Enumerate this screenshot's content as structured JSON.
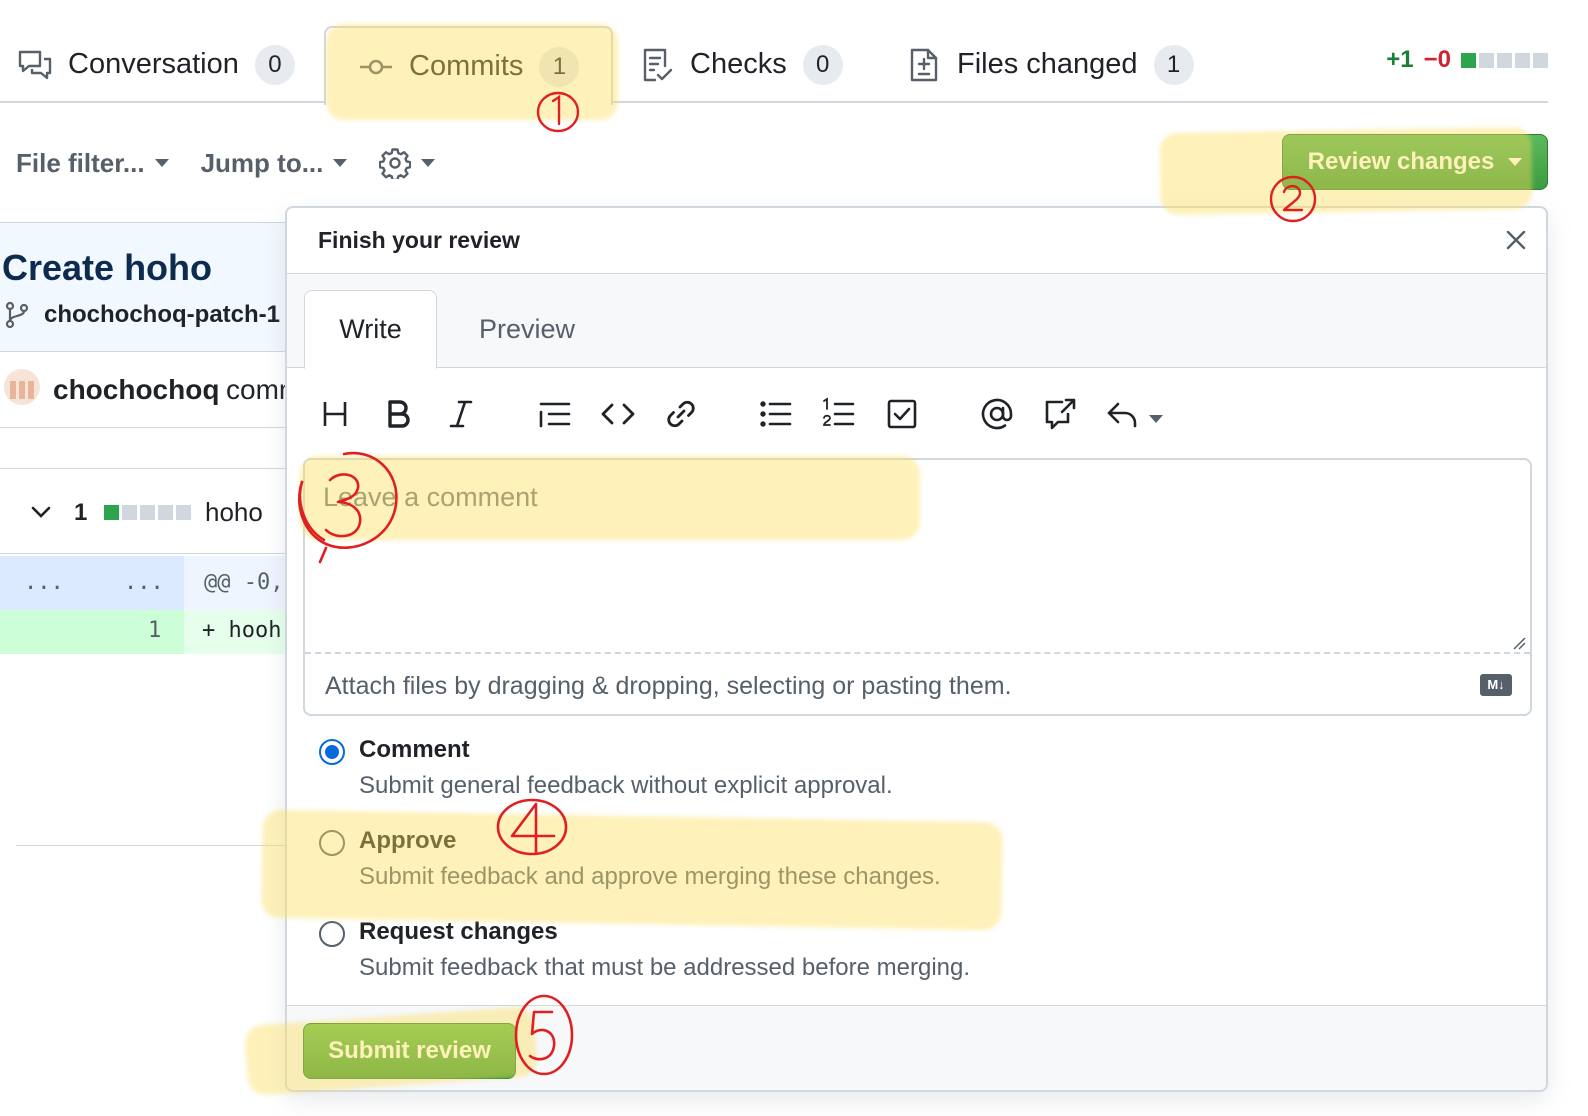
{
  "tabs": [
    {
      "label": "Conversation",
      "count": "0",
      "icon": "comment-discussion-icon"
    },
    {
      "label": "Commits",
      "count": "1",
      "icon": "git-commit-icon",
      "selected": true
    },
    {
      "label": "Checks",
      "count": "0",
      "icon": "checklist-icon"
    },
    {
      "label": "Files changed",
      "count": "1",
      "icon": "file-diff-icon"
    }
  ],
  "diffstat": {
    "additions": "+1",
    "deletions": "−0"
  },
  "toolbar": {
    "file_filter": "File filter...",
    "jump_to": "Jump to...",
    "settings_icon": "gear-icon",
    "review_button": "Review changes"
  },
  "pr": {
    "title": "Create hoho",
    "branch": "chochochoq-patch-1",
    "commit_user": "chochochoq",
    "commit_rest": "comm"
  },
  "file": {
    "count": "1",
    "name": "hoho",
    "hunk_left": "...",
    "hunk_right": "...",
    "hunk_header": "@@ -0,",
    "line_number": "1",
    "line_code": "+ hooh"
  },
  "review": {
    "title": "Finish your review",
    "tab_write": "Write",
    "tab_preview": "Preview",
    "placeholder": "Leave a comment",
    "attach_hint": "Attach files by dragging & dropping, selecting or pasting them.",
    "markdown_badge": "M↓",
    "options": [
      {
        "label": "Comment",
        "description": "Submit general feedback without explicit approval.",
        "checked": true
      },
      {
        "label": "Approve",
        "description": "Submit feedback and approve merging these changes.",
        "checked": false
      },
      {
        "label": "Request changes",
        "description": "Submit feedback that must be addressed before merging.",
        "checked": false
      }
    ],
    "submit": "Submit review"
  },
  "annotations": [
    "1",
    "2",
    "3",
    "4",
    "5"
  ],
  "colors": {
    "primary_green": "#2da44e",
    "link_blue": "#0969da",
    "annotation_red": "#e02020",
    "highlight_yellow": "#fcde5a"
  }
}
